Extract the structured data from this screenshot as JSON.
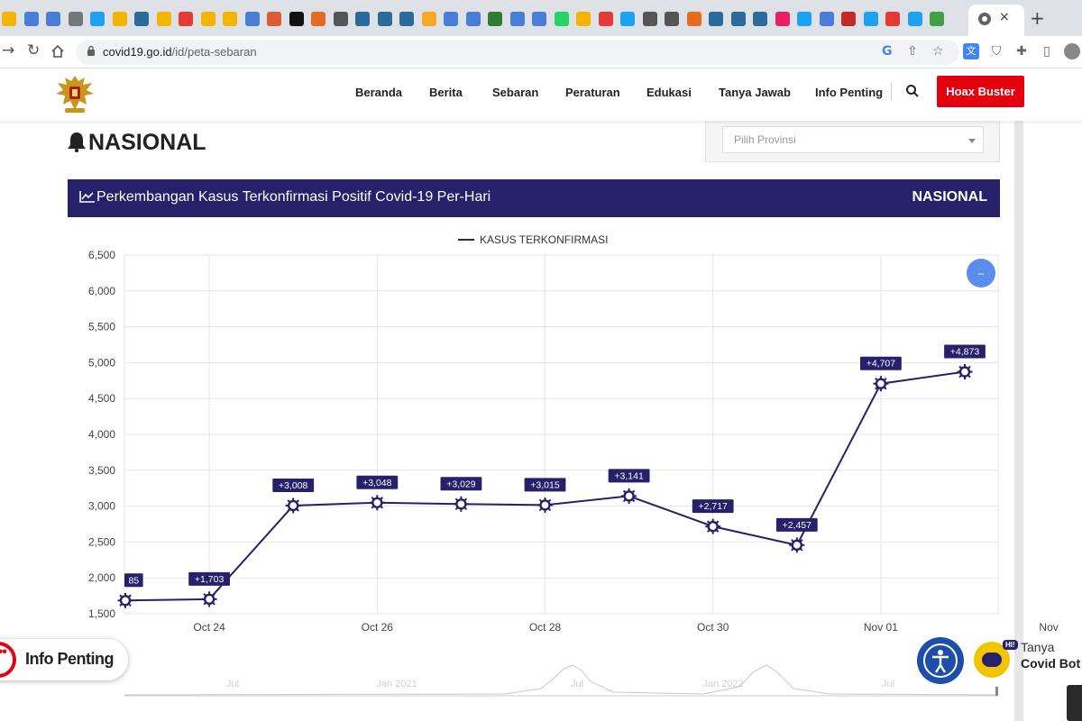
{
  "browser": {
    "url_host": "covid19.go.id",
    "url_path": "/id/peta-sebaran",
    "close_glyph": "×",
    "newtab_glyph": "+"
  },
  "site": {
    "logo": "garuda-emblem",
    "nav": [
      "Beranda",
      "Berita",
      "Sebaran",
      "Peraturan",
      "Edukasi",
      "Tanya Jawab",
      "Info Penting"
    ],
    "hoax_button": "Hoax Buster"
  },
  "page": {
    "heading": "NASIONAL",
    "province_placeholder": "Pilih Provinsi",
    "chart_header_title": "Perkembangan Kasus Terkonfirmasi Positif Covid-19 Per-Hari",
    "chart_header_right": "NASIONAL",
    "zoom_reset_glyph": "–"
  },
  "widgets": {
    "info_penting": "Info Penting",
    "covid_bot_line1": "Tanya",
    "covid_bot_line2": "Covid Bot",
    "bot_hi": "HI!",
    "accessibility_label": "CTRL + F2 ACCESSIBILITY"
  },
  "colors": {
    "navy": "#27216b",
    "red": "#e3000f",
    "zoom_button": "#5b8def"
  },
  "chart_data": {
    "type": "line",
    "legend": "KASUS TERKONFIRMASI",
    "yticks": [
      "6,500",
      "6,000",
      "5,500",
      "5,000",
      "4,500",
      "4,000",
      "3,500",
      "3,000",
      "2,500",
      "2,000",
      "1,500"
    ],
    "ylim": [
      1500,
      6500
    ],
    "xticks": [
      "Oct 24",
      "Oct 26",
      "Oct 28",
      "Oct 30",
      "Nov 01",
      "Nov"
    ],
    "x": [
      "2022-10-23",
      "2022-10-24",
      "2022-10-25",
      "2022-10-26",
      "2022-10-27",
      "2022-10-28",
      "2022-10-29",
      "2022-10-30",
      "2022-10-31",
      "2022-11-01",
      "2022-11-02"
    ],
    "values": [
      1685,
      1703,
      3008,
      3048,
      3029,
      3015,
      3141,
      2717,
      2457,
      4707,
      4873
    ],
    "labels": [
      "85",
      "+1,703",
      "+3,008",
      "+3,048",
      "+3,029",
      "+3,015",
      "+3,141",
      "+2,717",
      "+2,457",
      "+4,707",
      "+4,873"
    ],
    "grid": true,
    "navigator_ticks": [
      "Jul",
      "Jan 2021",
      "Jul",
      "Jan 2022",
      "Jul"
    ]
  }
}
